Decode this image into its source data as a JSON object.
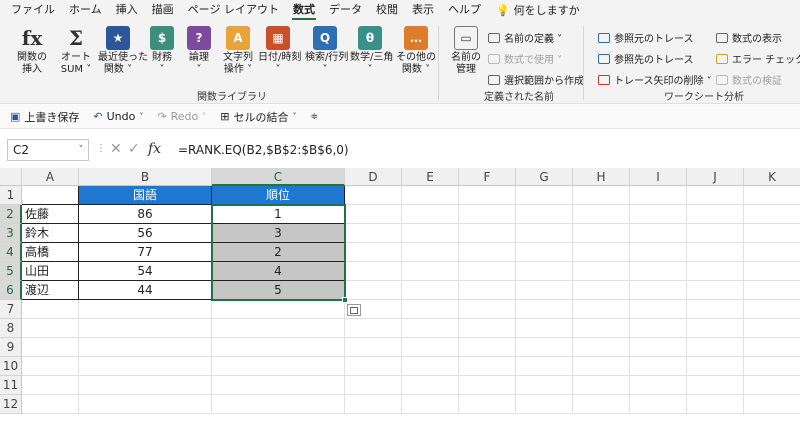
{
  "menu": {
    "tabs": [
      "ファイル",
      "ホーム",
      "挿入",
      "描画",
      "ページ レイアウト",
      "数式",
      "データ",
      "校閲",
      "表示",
      "ヘルプ"
    ],
    "active": "数式",
    "tell_me": "何をしますか"
  },
  "ribbon": {
    "function_library": {
      "label": "関数ライブラリ",
      "buttons": [
        {
          "label": "関数の\n挿入",
          "icon": "fx-icon",
          "glyph": "fx",
          "color": "#f3f3f3"
        },
        {
          "label": "オート\nSUM ˅",
          "icon": "sum-icon",
          "glyph": "Σ",
          "color": "#f3f3f3"
        },
        {
          "label": "最近使った\n関数 ˅",
          "icon": "star-icon",
          "glyph": "★",
          "color": "#2b579a"
        },
        {
          "label": "財務\n˅",
          "icon": "finance-icon",
          "glyph": "$",
          "color": "#3e8e7e"
        },
        {
          "label": "論理\n˅",
          "icon": "logic-icon",
          "glyph": "?",
          "color": "#7d4a9e"
        },
        {
          "label": "文字列\n操作 ˅",
          "icon": "text-icon",
          "glyph": "A",
          "color": "#e8a33a"
        },
        {
          "label": "日付/時刻\n˅",
          "icon": "calendar-icon",
          "glyph": "▦",
          "color": "#c9502b"
        },
        {
          "label": "検索/行列\n˅",
          "icon": "lookup-icon",
          "glyph": "Q",
          "color": "#2f6db5"
        },
        {
          "label": "数学/三角\n˅",
          "icon": "math-icon",
          "glyph": "θ",
          "color": "#3a8f8a"
        },
        {
          "label": "その他の\n関数 ˅",
          "icon": "more-functions-icon",
          "glyph": "…",
          "color": "#e07b2a"
        }
      ]
    },
    "defined_names": {
      "label": "定義された名前",
      "name_manager": "名前の\n管理",
      "define_name": "名前の定義 ˅",
      "use_in_formula": "数式で使用 ˅",
      "create_from_selection": "選択範囲から作成"
    },
    "formula_auditing": {
      "label": "ワークシート分析",
      "trace_precedents": "参照元のトレース",
      "trace_dependents": "参照先のトレース",
      "remove_arrows": "トレース矢印の削除 ˅",
      "show_formulas": "数式の表示",
      "error_checking": "エラー チェック ˅",
      "evaluate_formula": "数式の検証"
    }
  },
  "qat": {
    "save": "上書き保存",
    "undo": "Undo",
    "redo": "Redo",
    "merge": "セルの結合"
  },
  "formula_bar": {
    "name_box": "C2",
    "formula": "=RANK.EQ(B2,$B$2:$B$6,0)"
  },
  "sheet": {
    "columns": [
      "A",
      "B",
      "C",
      "D",
      "E",
      "F",
      "G",
      "H",
      "I",
      "J",
      "K"
    ],
    "rows": [
      "1",
      "2",
      "3",
      "4",
      "5",
      "6",
      "7",
      "8",
      "9",
      "10",
      "11",
      "12"
    ],
    "header_row": [
      "",
      "国語",
      "順位"
    ],
    "data": [
      [
        "佐藤",
        "86",
        "1"
      ],
      [
        "鈴木",
        "56",
        "3"
      ],
      [
        "高橋",
        "77",
        "2"
      ],
      [
        "山田",
        "54",
        "4"
      ],
      [
        "渡辺",
        "44",
        "5"
      ]
    ],
    "header_fill": "#1f77d0",
    "highlight_fill": "#c6c6c6",
    "selection_color": "#217346"
  }
}
